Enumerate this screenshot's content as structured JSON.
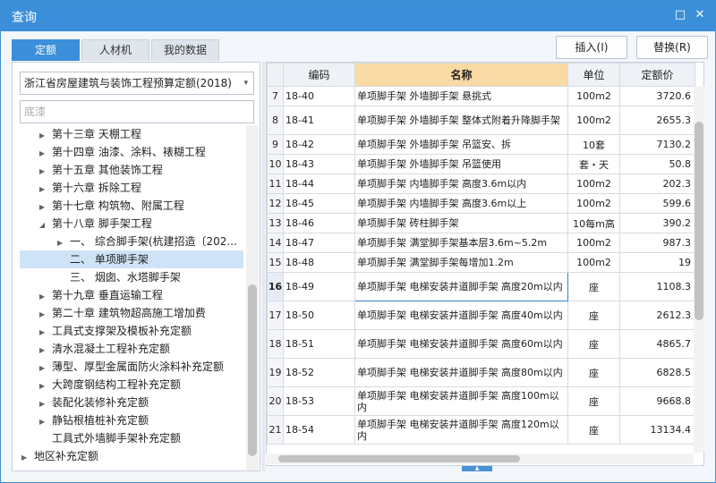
{
  "window": {
    "title": "查询",
    "maximize_icon": "□",
    "close_icon": "✕"
  },
  "tabs": [
    {
      "label": "定额",
      "active": true
    },
    {
      "label": "人材机",
      "active": false
    },
    {
      "label": "我的数据",
      "active": false
    }
  ],
  "buttons": {
    "insert": "插入(I)",
    "replace": "替换(R)"
  },
  "quota_select": {
    "value": "浙江省房屋建筑与装饰工程预算定额(2018)",
    "arrow": "▾"
  },
  "search": {
    "placeholder": "底漆"
  },
  "tree": {
    "items": [
      {
        "label": "第十三章 天棚工程",
        "twisty": "▶"
      },
      {
        "label": "第十四章 油漆、涂料、裱糊工程",
        "twisty": "▶"
      },
      {
        "label": "第十五章 其他装饰工程",
        "twisty": "▶"
      },
      {
        "label": "第十六章 拆除工程",
        "twisty": "▶"
      },
      {
        "label": "第十七章 构筑物、附属工程",
        "twisty": "▶"
      },
      {
        "label": "第十八章 脚手架工程",
        "twisty": "◢"
      },
      {
        "label": "一、 综合脚手架(杭建招造〔202...",
        "twisty": "▶"
      },
      {
        "label": "二、 单项脚手架",
        "twisty": "",
        "selected": true
      },
      {
        "label": "三、 烟囱、水塔脚手架",
        "twisty": ""
      },
      {
        "label": "第十九章 垂直运输工程",
        "twisty": "▶"
      },
      {
        "label": "第二十章 建筑物超高施工增加费",
        "twisty": "▶"
      },
      {
        "label": "工具式支撑架及模板补充定额",
        "twisty": "▶"
      },
      {
        "label": "清水混凝土工程补充定额",
        "twisty": "▶"
      },
      {
        "label": "薄型、厚型金属面防火涂料补充定额",
        "twisty": "▶"
      },
      {
        "label": "大跨度钢结构工程补充定额",
        "twisty": "▶"
      },
      {
        "label": "装配化装修补充定额",
        "twisty": "▶"
      },
      {
        "label": "静钻根植桩补充定额",
        "twisty": "▶"
      },
      {
        "label": "工具式外墙脚手架补充定额",
        "twisty": ""
      },
      {
        "label": "地区补充定额",
        "twisty": "▶"
      }
    ]
  },
  "grid": {
    "headers": {
      "rownum": "",
      "code": "编码",
      "name": "名称",
      "unit": "单位",
      "price": "定额价"
    },
    "rows": [
      {
        "n": "7",
        "code": "18-40",
        "name": "单项脚手架 外墙脚手架 悬挑式",
        "unit": "100m2",
        "price": "3720.6"
      },
      {
        "n": "8",
        "code": "18-41",
        "name": "单项脚手架 外墙脚手架 整体式附着升降脚手架",
        "unit": "100m2",
        "price": "2655.3"
      },
      {
        "n": "9",
        "code": "18-42",
        "name": "单项脚手架 外墙脚手架 吊篮安、拆",
        "unit": "10套",
        "price": "7130.2"
      },
      {
        "n": "10",
        "code": "18-43",
        "name": "单项脚手架 外墙脚手架 吊篮使用",
        "unit": "套・天",
        "price": "50.8"
      },
      {
        "n": "11",
        "code": "18-44",
        "name": "单项脚手架 内墙脚手架 高度3.6m以内",
        "unit": "100m2",
        "price": "202.3"
      },
      {
        "n": "12",
        "code": "18-45",
        "name": "单项脚手架 内墙脚手架 高度3.6m以上",
        "unit": "100m2",
        "price": "599.6"
      },
      {
        "n": "13",
        "code": "18-46",
        "name": "单项脚手架 砖柱脚手架",
        "unit": "10每m高",
        "price": "390.2"
      },
      {
        "n": "14",
        "code": "18-47",
        "name": "单项脚手架 满堂脚手架基本层3.6m~5.2m",
        "unit": "100m2",
        "price": "987.3"
      },
      {
        "n": "15",
        "code": "18-48",
        "name": "单项脚手架 满堂脚手架每增加1.2m",
        "unit": "100m2",
        "price": "19"
      },
      {
        "n": "16",
        "code": "18-49",
        "name": "单项脚手架 电梯安装井道脚手架 高度20m以内",
        "unit": "座",
        "price": "1108.3",
        "current": true
      },
      {
        "n": "17",
        "code": "18-50",
        "name": "单项脚手架 电梯安装井道脚手架 高度40m以内",
        "unit": "座",
        "price": "2612.3"
      },
      {
        "n": "18",
        "code": "18-51",
        "name": "单项脚手架 电梯安装井道脚手架 高度60m以内",
        "unit": "座",
        "price": "4865.7"
      },
      {
        "n": "19",
        "code": "18-52",
        "name": "单项脚手架 电梯安装井道脚手架 高度80m以内",
        "unit": "座",
        "price": "6828.5"
      },
      {
        "n": "20",
        "code": "18-53",
        "name": "单项脚手架 电梯安装井道脚手架 高度100m以内",
        "unit": "座",
        "price": "9668.8"
      },
      {
        "n": "21",
        "code": "18-54",
        "name": "单项脚手架 电梯安装井道脚手架 高度120m以内",
        "unit": "座",
        "price": "13134.4"
      }
    ]
  },
  "colors": {
    "accent": "#3b8fd9",
    "name_header": "#f9d9a4",
    "selection": "#cfe3f6"
  }
}
